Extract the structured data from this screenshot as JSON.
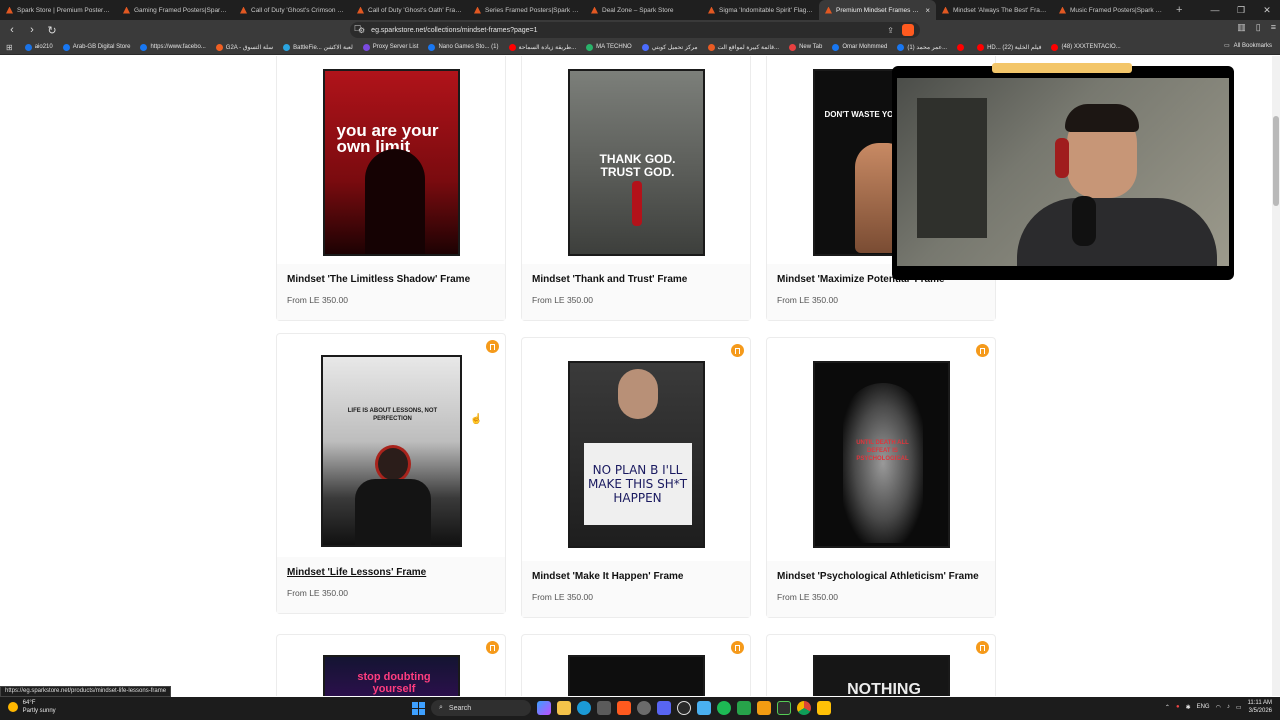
{
  "tabs": [
    {
      "label": "Spark Store | Premium Posters, Fra...",
      "active": false
    },
    {
      "label": "Gaming Framed Posters|Spark Sto...",
      "active": false
    },
    {
      "label": "Call of Duty 'Ghost's Crimson Spe...",
      "active": false
    },
    {
      "label": "Call of Duty 'Ghost's Oath' Framed...",
      "active": false
    },
    {
      "label": "Series Framed Posters|Spark Store",
      "active": false
    },
    {
      "label": "Deal Zone – Spark Store",
      "active": false
    },
    {
      "label": "Sigma 'Indomitable Spirit' Flag|Sp...",
      "active": false
    },
    {
      "label": "Premium Mindset Frames & M...",
      "active": true
    },
    {
      "label": "Mindset 'Always The Best' Frame |...",
      "active": false
    },
    {
      "label": "Music Framed Posters|Spark Store",
      "active": false
    }
  ],
  "address": "eg.sparkstore.net/collections/mindset-frames?page=1",
  "bookmarks": [
    {
      "label": "aio210",
      "color": "#1a73e8"
    },
    {
      "label": "Arab-GB Digital Store",
      "color": "#1877f2"
    },
    {
      "label": "https://www.facebo...",
      "color": "#1877f2"
    },
    {
      "label": "G2A - سلة التسوق",
      "color": "#f05f22"
    },
    {
      "label": "BattleFie... لعبة الاكشن",
      "color": "#2aa4e0"
    },
    {
      "label": "Proxy Server List",
      "color": "#7a4ae0"
    },
    {
      "label": "Nano Games Sto... (1)",
      "color": "#1877f2"
    },
    {
      "label": "طريقة زيادة السماحة...",
      "color": "#ff0000"
    },
    {
      "label": "MA TECHNO",
      "color": "#29b36a"
    },
    {
      "label": "مركز تحميل كوبتي",
      "color": "#4b6cff"
    },
    {
      "label": "قائمة كبيرة لمواقع الت...",
      "color": "#e95b23"
    },
    {
      "label": "New Tab",
      "color": "#e94040"
    },
    {
      "label": "Omar Mohmmed",
      "color": "#1877f2"
    },
    {
      "label": "(1) عمر محمد...",
      "color": "#1877f2"
    },
    {
      "label": "",
      "color": "#ff0000"
    },
    {
      "label": "HD... فيلم الخلية (22)",
      "color": "#ff0000"
    },
    {
      "label": "(48) XXXTENTACIO...",
      "color": "#ff0000"
    }
  ],
  "all_bookmarks": "All Bookmarks",
  "products": [
    {
      "title": "Mindset 'The Limitless Shadow' Frame",
      "price": "From LE 350.00",
      "poster_text": "you are your own limit",
      "accent": "#c4141c"
    },
    {
      "title": "Mindset 'Thank and Trust' Frame",
      "price": "From LE 350.00",
      "poster_text": "THANK GOD. TRUST GOD.",
      "accent": "#3d3d3d"
    },
    {
      "title": "Mindset 'Maximize Potential' Frame",
      "price": "From LE 350.00",
      "poster_text": "DON'T WASTE YOUR POTE",
      "accent": "#151515"
    },
    {
      "title": "Mindset 'Life Lessons' Frame",
      "price": "From LE 350.00",
      "poster_text": "LIFE IS ABOUT LESSONS, NOT PERFECTION",
      "accent": "#cfcfcf"
    },
    {
      "title": "Mindset 'Make It Happen' Frame",
      "price": "From LE 350.00",
      "poster_text": "NO PLAN B I'LL MAKE THIS SH*T HAPPEN",
      "accent": "#2a2a2a"
    },
    {
      "title": "Mindset 'Psychological Athleticism' Frame",
      "price": "From LE 350.00",
      "poster_text": "UNTIL DEATH ALL DEFEAT IS PSYCHOLOGICAL",
      "accent": "#0d0d0d"
    },
    {
      "title": "",
      "price": "",
      "poster_text": "stop doubting yourself",
      "accent": "#3a0d5c"
    },
    {
      "title": "",
      "price": "",
      "poster_text": "",
      "accent": "#111111"
    },
    {
      "title": "",
      "price": "",
      "poster_text": "NOTHING",
      "accent": "#1a1a1a"
    }
  ],
  "status_url": "https://eg.sparkstore.net/products/mindset-life-lessons-frame",
  "taskbar": {
    "temp": "64°F",
    "weather": "Partly sunny",
    "search": "Search",
    "lang": "ENG",
    "time": "11:11 AM",
    "date": "3/5/2026"
  }
}
